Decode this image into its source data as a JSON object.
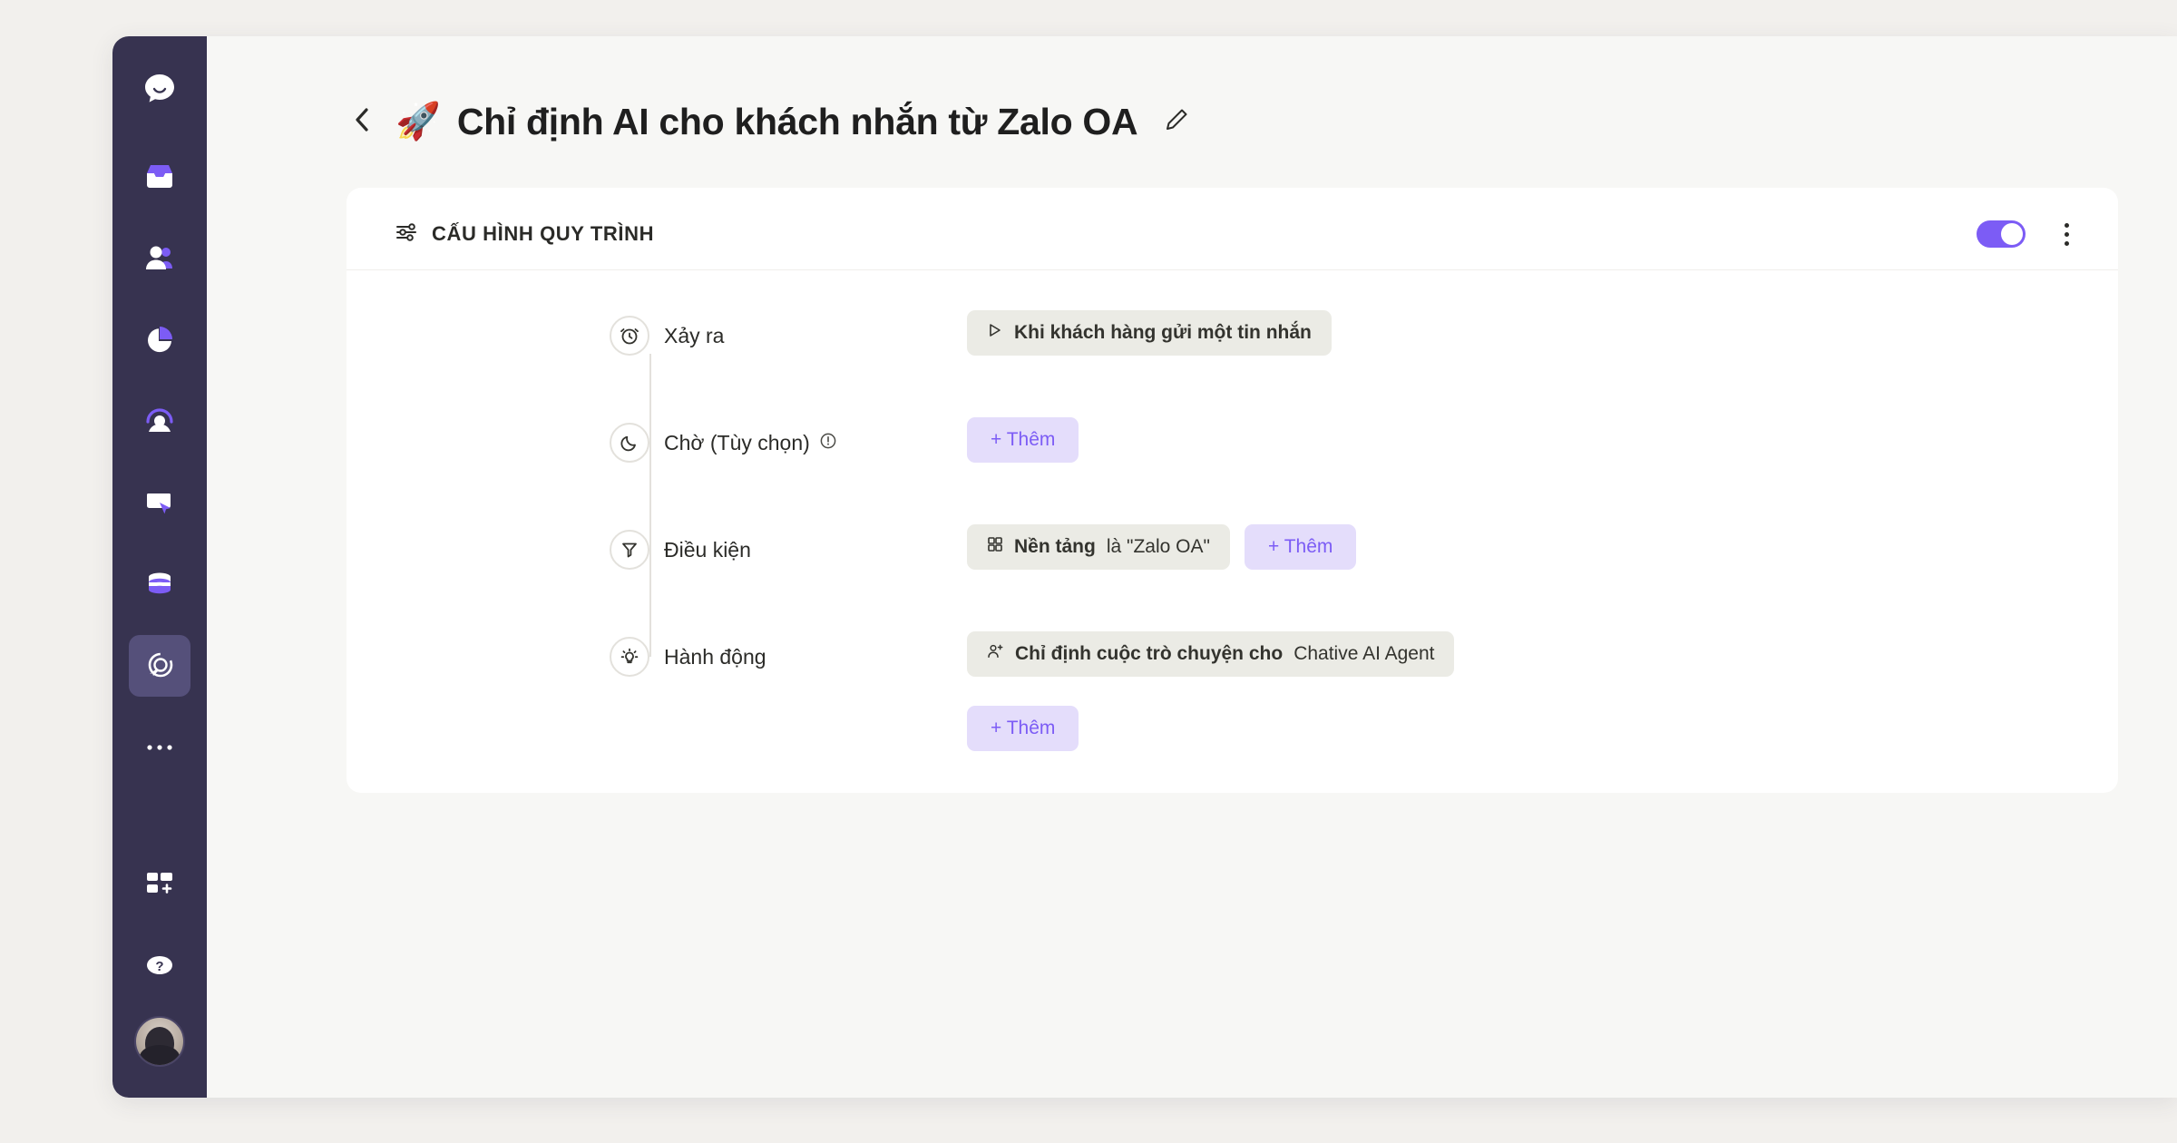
{
  "sidebar": {
    "items": [
      {
        "name": "logo",
        "icon": "chat-bubble-logo-icon"
      },
      {
        "name": "inbox",
        "icon": "inbox-icon"
      },
      {
        "name": "contacts",
        "icon": "people-icon"
      },
      {
        "name": "analytics",
        "icon": "pie-chart-icon"
      },
      {
        "name": "visitors",
        "icon": "user-circle-icon"
      },
      {
        "name": "campaigns",
        "icon": "card-click-icon"
      },
      {
        "name": "data",
        "icon": "database-icon"
      },
      {
        "name": "automation",
        "icon": "automation-radar-icon",
        "active": true
      },
      {
        "name": "more",
        "icon": "ellipsis-icon"
      },
      {
        "name": "apps",
        "icon": "add-app-grid-icon"
      },
      {
        "name": "help",
        "icon": "question-mark-icon"
      }
    ],
    "avatar": {
      "name": "user-avatar"
    }
  },
  "header": {
    "back_icon": "chevron-left-icon",
    "emoji": "🚀",
    "title": "Chỉ định AI cho khách nhắn từ Zalo OA",
    "edit_icon": "pencil-icon"
  },
  "card": {
    "icon": "sliders-icon",
    "title": "CẤU HÌNH QUY TRÌNH",
    "toggle": {
      "state": "on",
      "color": "#7c5cf5"
    },
    "menu_icon": "kebab-menu-icon"
  },
  "steps": [
    {
      "key": "trigger",
      "icon": "alarm-clock-icon",
      "label": "Xảy ra",
      "info": false,
      "chips": [
        {
          "icon": "play-triangle-icon",
          "bold": "Khi khách hàng gửi một tin nhắn",
          "plain": ""
        }
      ],
      "add_label": "",
      "has_add": false,
      "add_on_new_line": false
    },
    {
      "key": "wait",
      "icon": "moon-icon",
      "label": "Chờ (Tùy chọn)",
      "info": true,
      "info_icon": "info-exclamation-icon",
      "chips": [],
      "add_label": "+ Thêm",
      "has_add": true,
      "add_on_new_line": false
    },
    {
      "key": "condition",
      "icon": "filter-funnel-icon",
      "label": "Điều kiện",
      "info": false,
      "chips": [
        {
          "icon": "grid-2x2-icon",
          "bold": "Nền tảng",
          "plain": "là \"Zalo OA\""
        }
      ],
      "add_label": "+ Thêm",
      "has_add": true,
      "add_on_new_line": false
    },
    {
      "key": "action",
      "icon": "lightbulb-icon",
      "label": "Hành động",
      "info": false,
      "chips": [
        {
          "icon": "user-plus-icon",
          "bold": "Chỉ định cuộc trò chuyện cho",
          "plain": "Chative AI Agent"
        }
      ],
      "add_label": "+ Thêm",
      "has_add": true,
      "add_on_new_line": true
    }
  ],
  "colors": {
    "sidebar_bg": "#373350",
    "sidebar_active": "#55507a",
    "accent": "#7c5cf5",
    "accent_soft": "#e4ddfb",
    "chip_bg": "#ebebe5",
    "page_bg": "#f2f0ed",
    "main_bg": "#f7f7f5"
  }
}
